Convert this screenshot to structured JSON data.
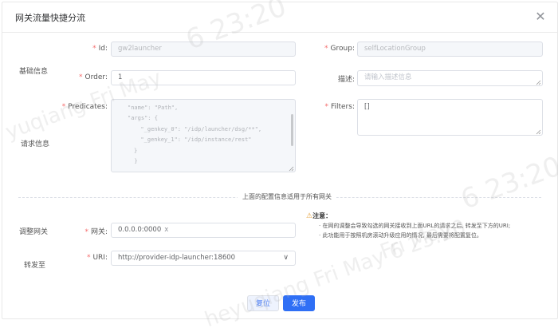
{
  "dialog": {
    "title": "网关流量快捷分流",
    "close_glyph": "✕"
  },
  "sections": {
    "basic": "基础信息",
    "request": "请求信息",
    "adjust_gateway": "调整网关",
    "forward_to": "转发至"
  },
  "form": {
    "id": {
      "label": "Id",
      "value": "gw2launcher"
    },
    "group": {
      "label": "Group",
      "value": "selfLocationGroup"
    },
    "order": {
      "label": "Order",
      "value": "1"
    },
    "description": {
      "label": "描述",
      "placeholder": "请输入描述信息"
    },
    "predicates": {
      "label": "Predicates",
      "lines": [
        "\"name\": \"Path\",",
        "\"args\": {",
        "  \"_genkey_0\": \"/idp/launcher/dsg/**\",",
        "  \"_genkey_1\": \"/idp/instance/rest\"",
        "}",
        "  }"
      ]
    },
    "filters": {
      "label": "Filters",
      "value": "[]"
    },
    "gateway": {
      "label": "网关",
      "tag": "0.0.0.0:0000",
      "tag_close": "x"
    },
    "uri": {
      "label": "URI",
      "value": "http://provider-idp-launcher:18600",
      "chevron": "∨"
    }
  },
  "divider_text": "上面的配置信息适用于所有网关",
  "note": {
    "icon": "⚠",
    "title": "注意：",
    "lines": [
      "· 在网的调整会导致勾选的网关接收到上面URL的请求之后, 转发至下方的URI;",
      "· 此功能用于按照机房滚动升级应用的情况, 最后需要将配置复位。"
    ]
  },
  "buttons": {
    "reset": "复位",
    "submit": "发布"
  },
  "watermark": [
    "6 23:20",
    "yuqiang Fri May",
    "6 23:20",
    "Fri May",
    "heyuqiang Fri May 6 23:20"
  ],
  "colors": {
    "primary": "#2f6ff5",
    "required": "#f56c6c",
    "warning": "#e6a23c"
  }
}
